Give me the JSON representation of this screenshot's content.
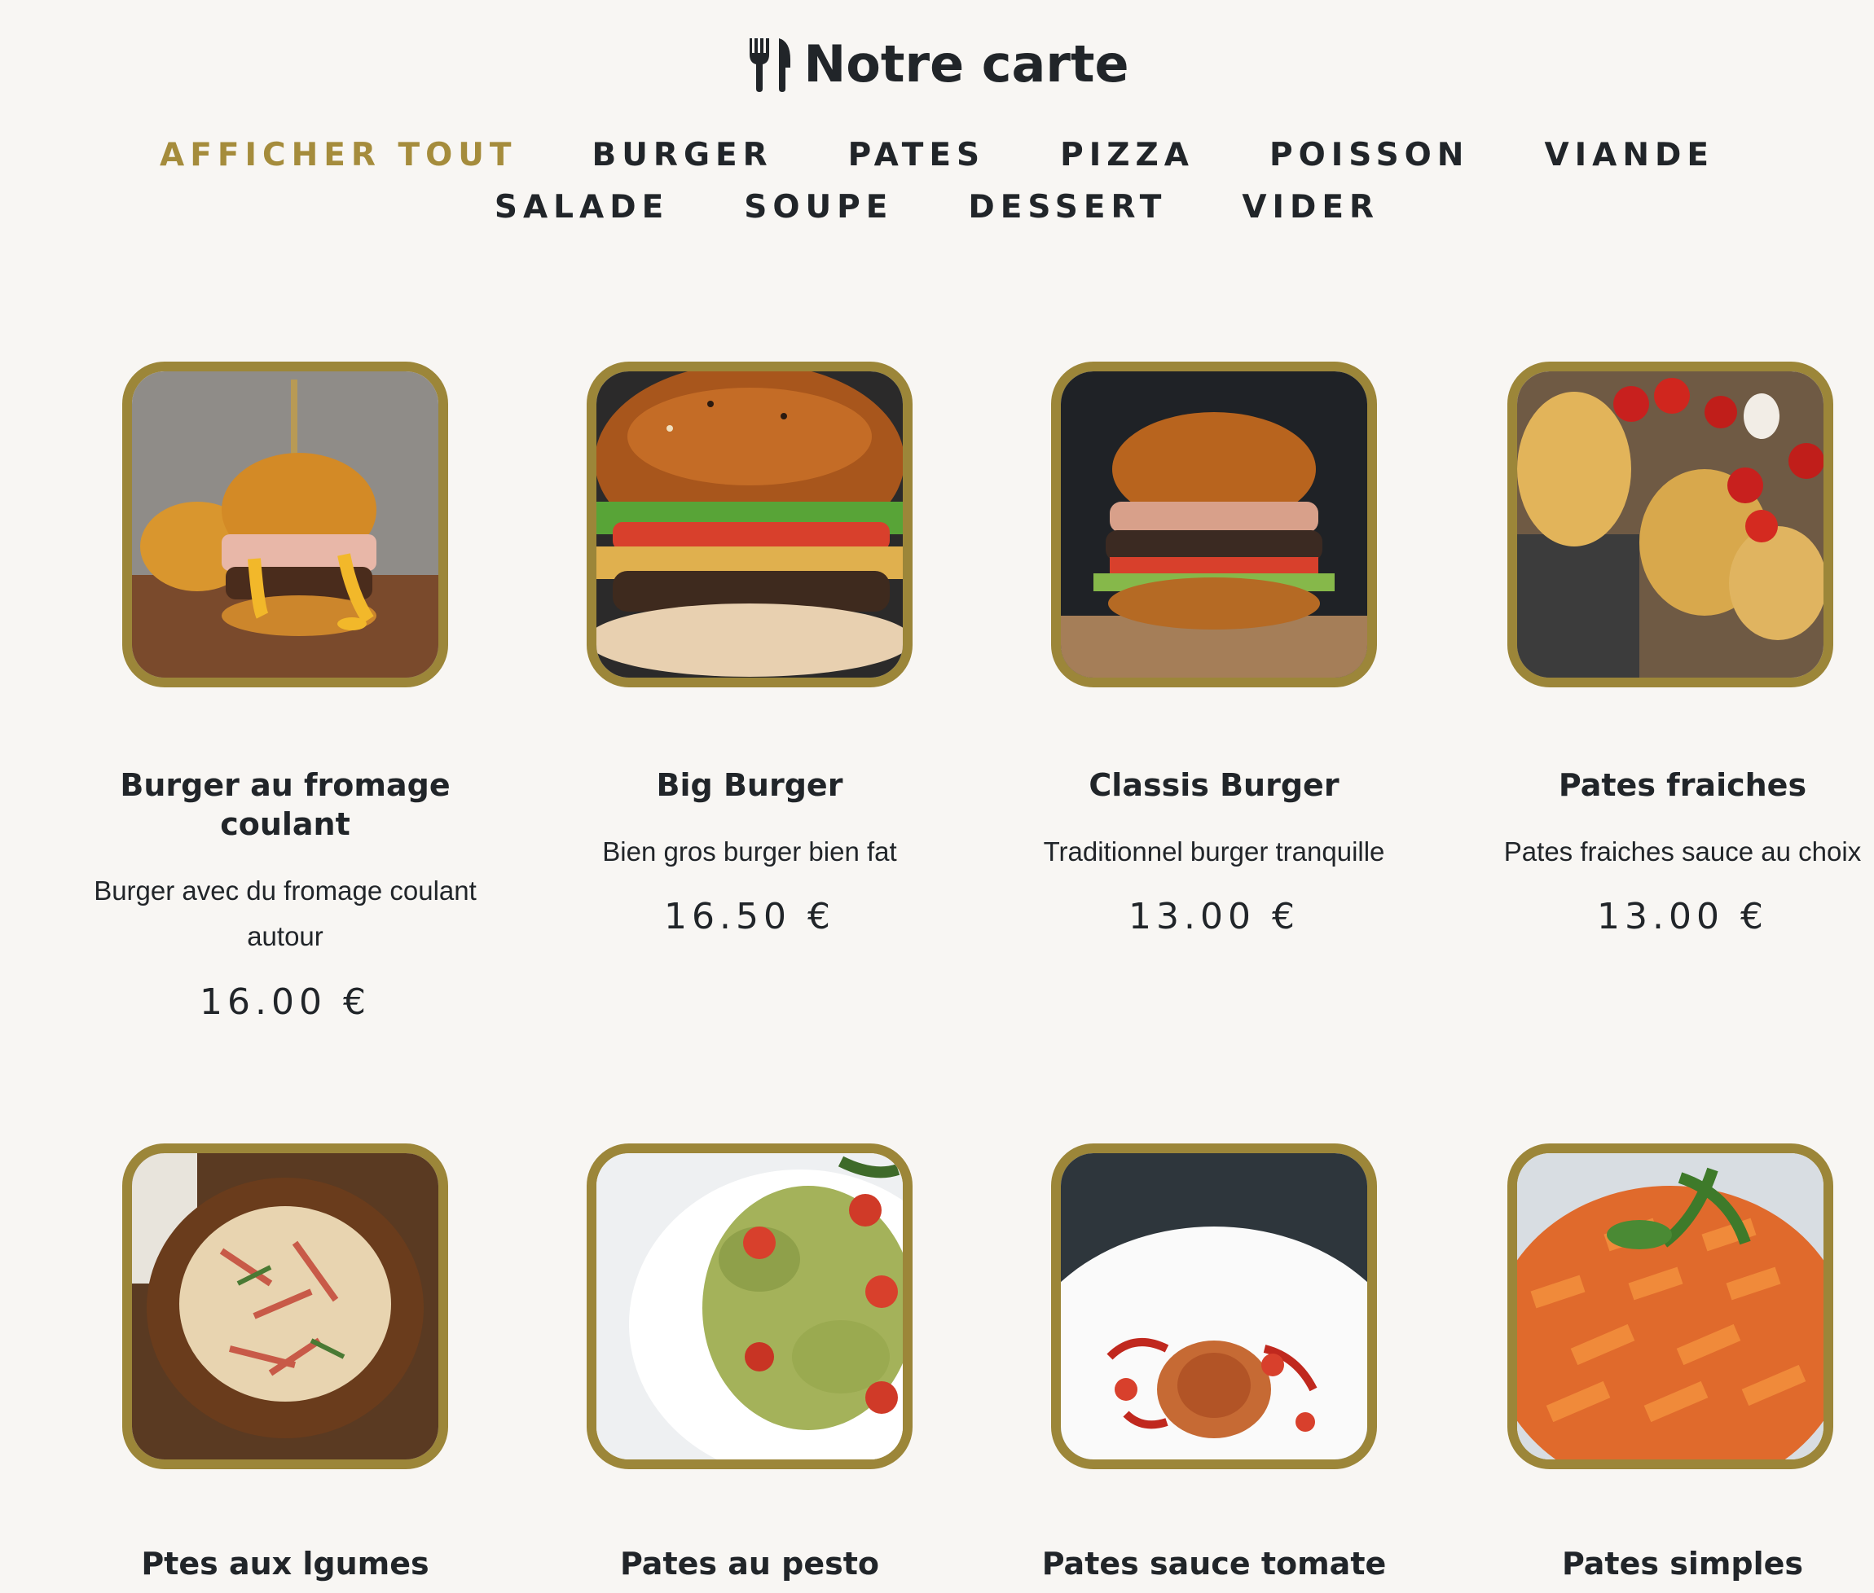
{
  "page": {
    "title": "Notre carte",
    "title_icon": "fork-knife-icon",
    "accent_color": "#a58c3c",
    "frame_color": "#9c8639",
    "background": "#f8f6f3"
  },
  "filters": [
    {
      "label": "AFFICHER TOUT",
      "active": true
    },
    {
      "label": "BURGER",
      "active": false
    },
    {
      "label": "PATES",
      "active": false
    },
    {
      "label": "PIZZA",
      "active": false
    },
    {
      "label": "POISSON",
      "active": false
    },
    {
      "label": "VIANDE",
      "active": false
    },
    {
      "label": "SALADE",
      "active": false
    },
    {
      "label": "SOUPE",
      "active": false
    },
    {
      "label": "DESSERT",
      "active": false
    },
    {
      "label": "VIDER",
      "active": false
    }
  ],
  "items": [
    {
      "name": "Burger au fromage coulant",
      "description": "Burger avec du fromage coulant autour",
      "price": "16.00 €",
      "image": "cheese-burger-photo"
    },
    {
      "name": "Big Burger",
      "description": "Bien gros burger bien fat",
      "price": "16.50 €",
      "image": "big-burger-photo"
    },
    {
      "name": "Classis Burger",
      "description": "Traditionnel burger tranquille",
      "price": "13.00 €",
      "image": "classic-burger-photo"
    },
    {
      "name": "Pates fraiches",
      "description": "Pates fraiches sauce au choix",
      "price": "13.00 €",
      "image": "fresh-pasta-photo"
    },
    {
      "name": "Ptes aux lgumes",
      "image": "vegetable-pasta-photo"
    },
    {
      "name": "Pates au pesto",
      "image": "pesto-pasta-photo"
    },
    {
      "name": "Pates sauce tomate",
      "image": "tomato-pasta-photo"
    },
    {
      "name": "Pates simples",
      "image": "penne-pasta-photo"
    }
  ]
}
